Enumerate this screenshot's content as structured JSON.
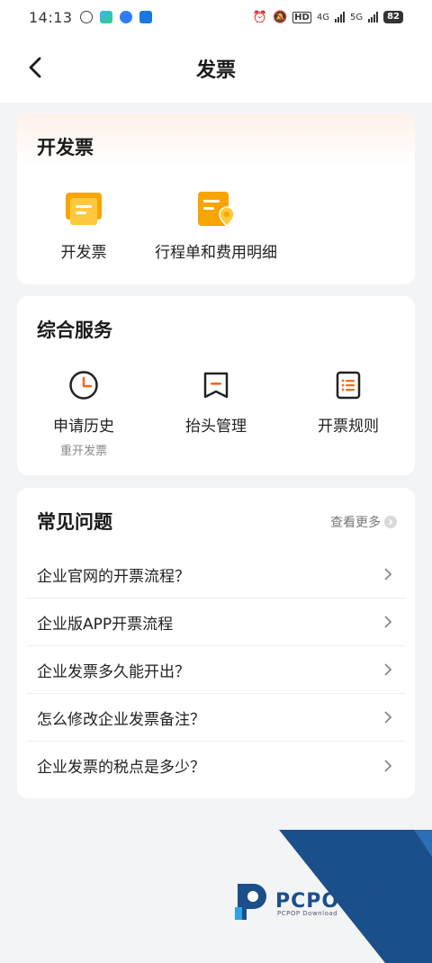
{
  "status_bar": {
    "time": "14:13",
    "network_1": "4G",
    "network_2": "5G",
    "hd": "HD",
    "battery": "82"
  },
  "nav": {
    "title": "发票"
  },
  "issue_card": {
    "title": "开发票",
    "items": [
      {
        "label": "开发票",
        "icon": "invoice-icon"
      },
      {
        "label": "行程单和费用明细",
        "icon": "itinerary-icon"
      }
    ]
  },
  "services_card": {
    "title": "综合服务",
    "items": [
      {
        "label": "申请历史",
        "sub": "重开发票",
        "icon": "clock-icon"
      },
      {
        "label": "抬头管理",
        "icon": "bookmark-icon"
      },
      {
        "label": "开票规则",
        "icon": "list-icon"
      }
    ]
  },
  "faq_card": {
    "title": "常见问题",
    "more_label": "查看更多",
    "items": [
      "企业官网的开票流程？",
      "企业版APP开票流程",
      "企业发票多久能开出？",
      "怎么修改企业发票备注？",
      "企业发票的税点是多少？"
    ]
  },
  "watermark": {
    "brand": "PCPOP下载",
    "sub": "PCPOP Download"
  },
  "colors": {
    "accent_orange": "#f7a500",
    "icon_orange": "#f26b1d",
    "watermark_blue": "#1b4f8a"
  }
}
